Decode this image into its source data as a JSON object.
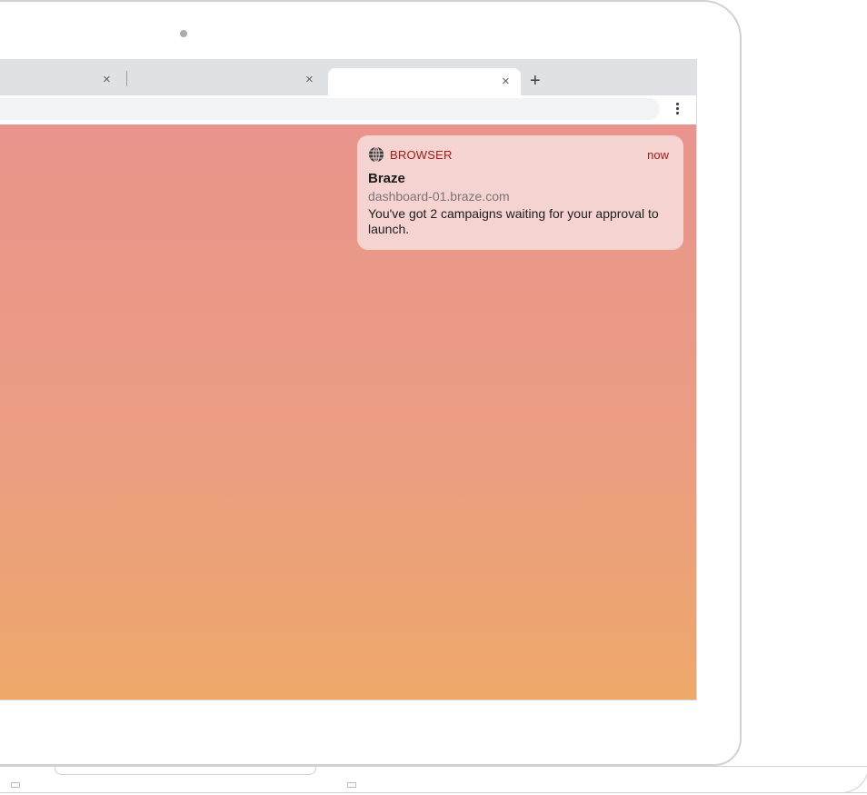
{
  "browser": {
    "tabs": [
      {
        "name": "tab-1",
        "close_glyph": "×",
        "active": false
      },
      {
        "name": "tab-2",
        "close_glyph": "×",
        "active": false
      },
      {
        "name": "tab-3",
        "close_glyph": "×",
        "active": true
      }
    ],
    "new_tab_glyph": "+",
    "menu_icon": "kebab-menu-icon"
  },
  "notification": {
    "icon": "globe-icon",
    "app_name": "BROWSER",
    "time": "now",
    "title": "Braze",
    "domain": "dashboard-01.braze.com",
    "body": "You've got 2 campaigns waiting for your approval to launch."
  },
  "colors": {
    "accent_red": "#a31b1b",
    "gradient_top": "#e9948d",
    "gradient_bottom": "#eea86a",
    "tabstrip": "#dfe1e5"
  }
}
